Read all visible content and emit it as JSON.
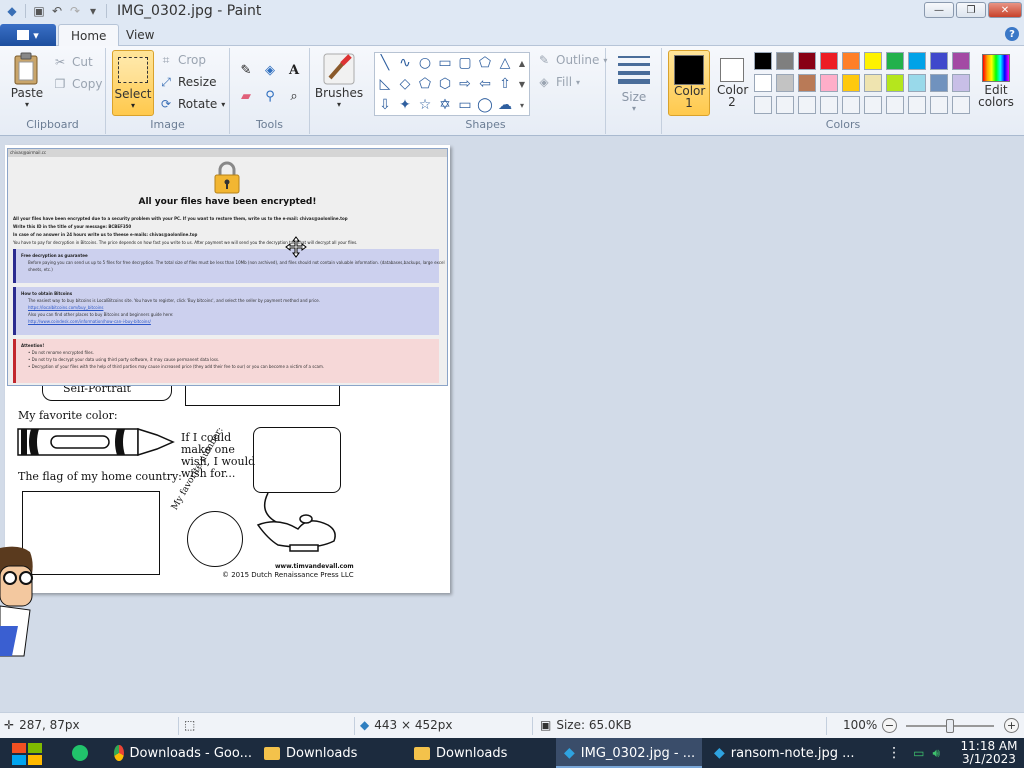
{
  "window": {
    "title": "IMG_0302.jpg - Paint",
    "minimize": "—",
    "restore": "❐",
    "close": "✕"
  },
  "tabs": {
    "file_menu": "▾",
    "home": "Home",
    "view": "View",
    "help": "?"
  },
  "clipboard": {
    "paste": "Paste",
    "cut": "Cut",
    "copy": "Copy",
    "label": "Clipboard"
  },
  "image": {
    "select": "Select",
    "crop": "Crop",
    "resize": "Resize",
    "rotate": "Rotate",
    "label": "Image"
  },
  "tools": {
    "label": "Tools",
    "brushes": "Brushes"
  },
  "shapes": {
    "outline": "Outline",
    "fill": "Fill",
    "label": "Shapes"
  },
  "size": {
    "label": "Size"
  },
  "colors": {
    "color1": "Color 1",
    "color2": "Color 2",
    "edit": "Edit colors",
    "label": "Colors",
    "color1_value": "#000000",
    "color2_value": "#ffffff",
    "palette_row1": [
      "#000000",
      "#7f7f7f",
      "#880015",
      "#ed1c24",
      "#ff7f27",
      "#fff200",
      "#22b14c",
      "#00a2e8",
      "#3f48cc",
      "#a349a4"
    ],
    "palette_row2": [
      "#ffffff",
      "#c3c3c3",
      "#b97a57",
      "#ffaec9",
      "#ffc90e",
      "#efe4b0",
      "#b5e61d",
      "#99d9ea",
      "#7092be",
      "#c8bfe7"
    ]
  },
  "note": {
    "window_title": "chivas@airmail.cc",
    "heading": "All your files have been encrypted!",
    "line1": "All your files have been encrypted due to a security problem with your PC. If you want to restore them, write us to the e-mail: chivas@aolonline.top",
    "line2": "Write this ID in the title of your message: BCBEF350",
    "line3": "In case of no answer in 24 hours write us to theese e-mails: chivas@aolonline.top",
    "line4": "You have to pay for decryption in Bitcoins. The price depends on how fast you write to us. After payment we will send you the decryption tool that will decrypt all your files.",
    "box1_title": "Free decryption as guarantee",
    "box1_text1": "Before paying you can send us up to 5 files for free decryption. The total size of files must be less than 10Mb (non archived), and files should not contain valuable information. (databases,backups, large excel",
    "box1_text2": "sheets, etc.)",
    "box2_title": "How to obtain Bitcoins",
    "box2_text1": "The easiest way to buy bitcoins is LocalBitcoins site. You have to register, click 'Buy bitcoins', and select the seller by payment method and price.",
    "box2_link1": "https://localbitcoins.com/buy_bitcoins",
    "box2_text2": "Also you can find other places to buy Bitcoins and beginners guide here:",
    "box2_link2": "http://www.coindesk.com/information/how-can-i-buy-bitcoins/",
    "box3_title": "Attention!",
    "box3_b1": "• Do not rename encrypted files.",
    "box3_b2": "• Do not try to decrypt your data using third party software, it may cause permanent data loss.",
    "box3_b3": "• Decryption of your files with the help of third parties may cause increased price (they add their fee to our) or you can become a victim of a scam."
  },
  "worksheet": {
    "self_portrait": "Self-Portrait",
    "fav_color": "My favorite color:",
    "wish": "If I could\nmake one\nwish, I would\nwish for...",
    "flag": "The flag of my home country:",
    "fav_number": "My favorite number:",
    "website": "www.timvandevall.com",
    "copyright": "© 2015 Dutch Renaissance Press LLC"
  },
  "status": {
    "cursor": "287, 87px",
    "selection_size": "443 × 452px",
    "file_size": "Size: 65.0KB",
    "zoom": "100%"
  },
  "taskbar": {
    "app1": "Downloads - Goo...",
    "app2": "Downloads",
    "app3": "Downloads",
    "app4": "IMG_0302.jpg - ...",
    "app5": "ransom-note.jpg ...",
    "time": "11:18 AM",
    "date": "3/1/2023"
  }
}
